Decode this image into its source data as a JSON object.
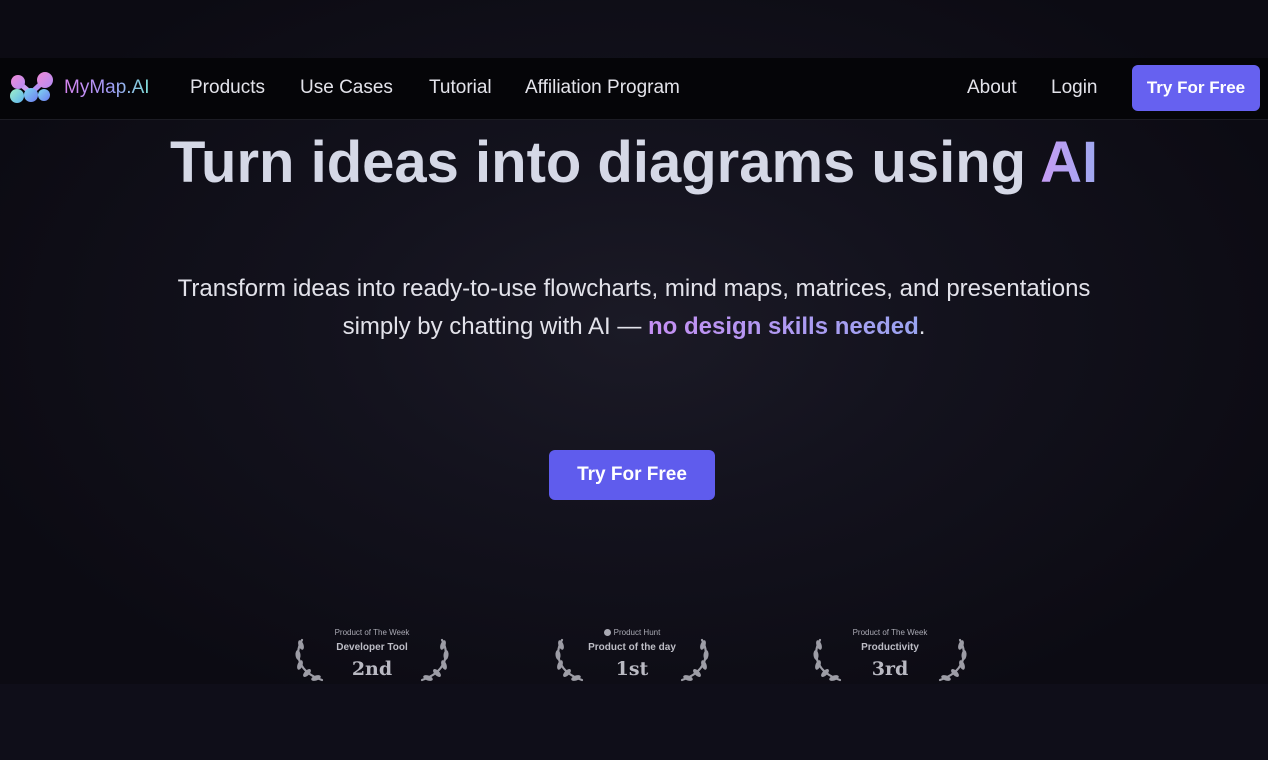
{
  "nav": {
    "brand": "MyMap.AI",
    "links": [
      "Products",
      "Use Cases",
      "Tutorial",
      "Affiliation Program"
    ],
    "about": "About",
    "login": "Login",
    "cta": "Try For Free"
  },
  "hero": {
    "title_main": "Turn ideas into diagrams using",
    "title_accent": "AI",
    "subtitle_line1": "Transform ideas into ready-to-use flowcharts, mind maps, matrices, and presentations",
    "subtitle_line2_start": "simply by chatting with AI — ",
    "subtitle_highlight": "no design skills needed",
    "subtitle_end": ".",
    "cta": "Try For Free"
  },
  "awards": [
    {
      "line1": "Product of The Week",
      "line2": "Developer Tool",
      "rank": "2nd"
    },
    {
      "line1": "Product Hunt",
      "line2": "Product of the day",
      "rank": "1st"
    },
    {
      "line1": "Product of The Week",
      "line2": "Productivity",
      "rank": "3rd"
    }
  ],
  "colors": {
    "background": "#0d0c16",
    "navbar": "#050508",
    "accent": "#6661f0",
    "brand_gradient_start": "#d985f2",
    "brand_gradient_end": "#7fe0d8"
  },
  "icons": {
    "logo": "mymap-logo-icon",
    "award_laurel": "laurel-wreath-icon",
    "product_hunt": "product-hunt-icon"
  }
}
